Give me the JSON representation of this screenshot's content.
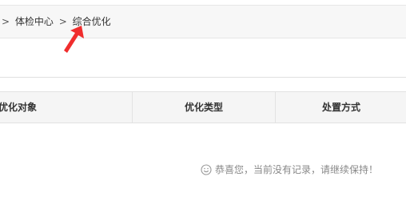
{
  "breadcrumb": {
    "items": [
      {
        "label": "体检中心"
      },
      {
        "label": "综合优化"
      }
    ],
    "separator": ">"
  },
  "table": {
    "columns": [
      {
        "label": "优化对象"
      },
      {
        "label": "优化类型"
      },
      {
        "label": "处置方式"
      }
    ]
  },
  "empty_state": {
    "icon": "smile-icon",
    "message": "恭喜您，当前没有记录，请继续保持！"
  },
  "colors": {
    "annotation_arrow": "#f02d2d",
    "header_bg": "#f5f5f5",
    "muted_text": "#888888"
  }
}
